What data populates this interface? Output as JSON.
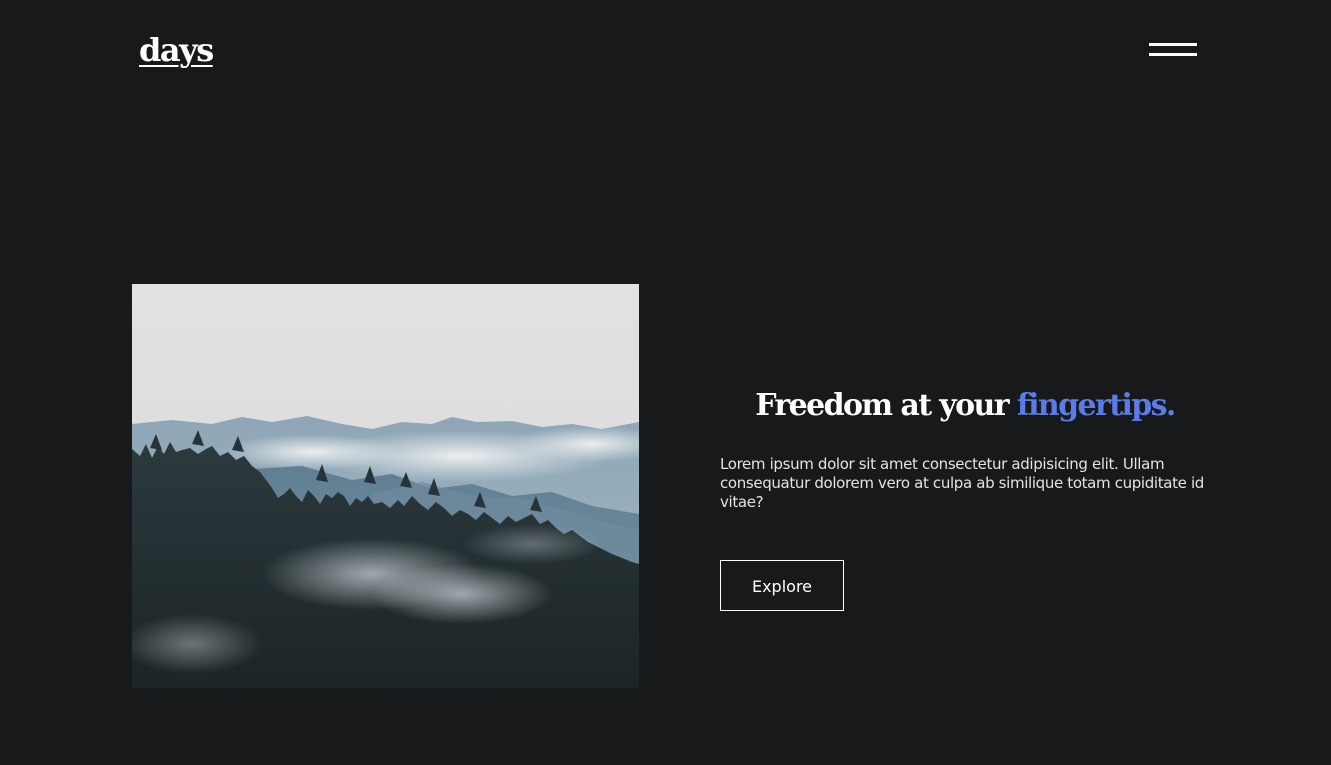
{
  "header": {
    "logo_text": "days",
    "menu_icon": "hamburger-menu-icon"
  },
  "hero": {
    "image_description_icon": "mountain-forest-photo",
    "headline_main": "Freedom at your ",
    "headline_accent": "fingertips.",
    "description": "Lorem ipsum dolor sit amet consectetur adipisicing elit. Ullam consequatur dolorem vero at culpa ab similique totam cupiditate id vitae?",
    "button_label": "Explore"
  },
  "colors": {
    "background": "#18191b",
    "accent": "#5b7be8",
    "text": "#ffffff"
  }
}
